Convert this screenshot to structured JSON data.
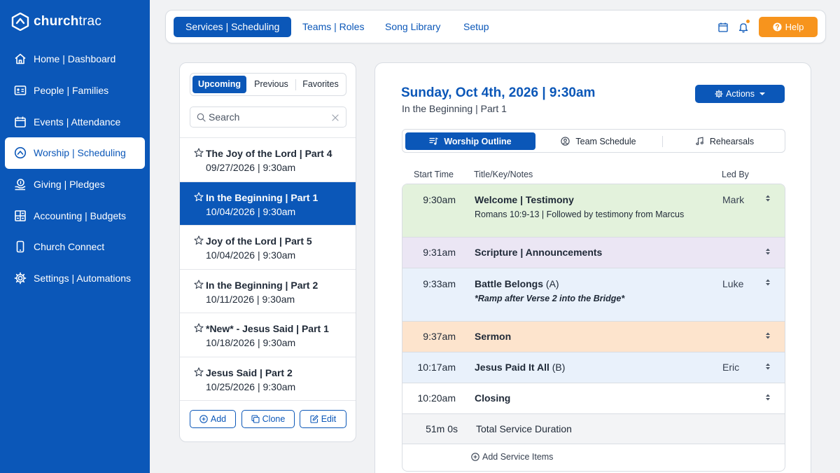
{
  "app": {
    "logo_text_bold": "church",
    "logo_text_light": "trac"
  },
  "sidebar": {
    "items": [
      {
        "label": "Home | Dashboard",
        "icon": "home-icon"
      },
      {
        "label": "People | Families",
        "icon": "id-card-icon"
      },
      {
        "label": "Events | Attendance",
        "icon": "calendar-icon"
      },
      {
        "label": "Worship | Scheduling",
        "icon": "worship-icon",
        "active": true
      },
      {
        "label": "Giving | Pledges",
        "icon": "giving-icon"
      },
      {
        "label": "Accounting | Budgets",
        "icon": "grid-icon"
      },
      {
        "label": "Church Connect",
        "icon": "phone-icon"
      },
      {
        "label": "Settings | Automations",
        "icon": "gear-icon"
      }
    ]
  },
  "topbar": {
    "tabs": [
      {
        "label": "Services | Scheduling",
        "active": true
      },
      {
        "label": "Teams | Roles"
      },
      {
        "label": "Song Library"
      },
      {
        "label": "Setup"
      }
    ],
    "help_label": "Help",
    "colors": {
      "accent": "#0b57b8",
      "help": "#f7941d"
    }
  },
  "services_panel": {
    "filters": [
      {
        "label": "Upcoming",
        "active": true
      },
      {
        "label": "Previous"
      },
      {
        "label": "Favorites"
      }
    ],
    "search_placeholder": "Search",
    "services": [
      {
        "title": "The Joy of the Lord | Part 4",
        "date": "09/27/2026 | 9:30am"
      },
      {
        "title": "In the Beginning | Part 1",
        "date": "10/04/2026 | 9:30am",
        "active": true
      },
      {
        "title": "Joy of the Lord | Part 5",
        "date": "10/04/2026 | 9:30am"
      },
      {
        "title": "In the Beginning | Part 2",
        "date": "10/11/2026 | 9:30am"
      },
      {
        "title": "*New* - Jesus Said | Part 1",
        "date": "10/18/2026 | 9:30am"
      },
      {
        "title": "Jesus Said | Part 2",
        "date": "10/25/2026 | 9:30am"
      }
    ],
    "buttons": {
      "add": "Add",
      "clone": "Clone",
      "edit": "Edit"
    }
  },
  "service_detail": {
    "title": "Sunday, Oct 4th, 2026 | 9:30am",
    "subtitle": "In the Beginning | Part 1",
    "actions_label": "Actions",
    "subtabs": [
      {
        "label": "Worship Outline",
        "active": true
      },
      {
        "label": "Team Schedule"
      },
      {
        "label": "Rehearsals"
      }
    ],
    "columns": {
      "start": "Start Time",
      "title": "Title/Key/Notes",
      "led": "Led By"
    },
    "items": [
      {
        "time": "9:30am",
        "title": "Welcome | Testimony",
        "key": "",
        "note": "Romans 10:9-13 | Followed by testimony from Marcus",
        "led": "Mark",
        "color": "#e3f2dc"
      },
      {
        "time": "9:31am",
        "title": "Scripture | Announcements",
        "key": "",
        "note": "",
        "led": "",
        "color": "#ebe6f4"
      },
      {
        "time": "9:33am",
        "title": "Battle Belongs",
        "key": "(A)",
        "note": "*Ramp after Verse 2 into the Bridge*",
        "led": "Luke",
        "color": "#e9f1fb"
      },
      {
        "time": "9:37am",
        "title": "Sermon",
        "key": "",
        "note": "",
        "led": "",
        "color": "#fde4cd"
      },
      {
        "time": "10:17am",
        "title": "Jesus Paid It All",
        "key": "(B)",
        "note": "",
        "led": "Eric",
        "color": "#e9f1fb"
      },
      {
        "time": "10:20am",
        "title": "Closing",
        "key": "",
        "note": "",
        "led": "",
        "color": "#ffffff"
      }
    ],
    "total": {
      "time": "51m 0s",
      "label": "Total Service Duration",
      "color": "#f3f4f6"
    },
    "add_items_label": "Add Service Items"
  }
}
